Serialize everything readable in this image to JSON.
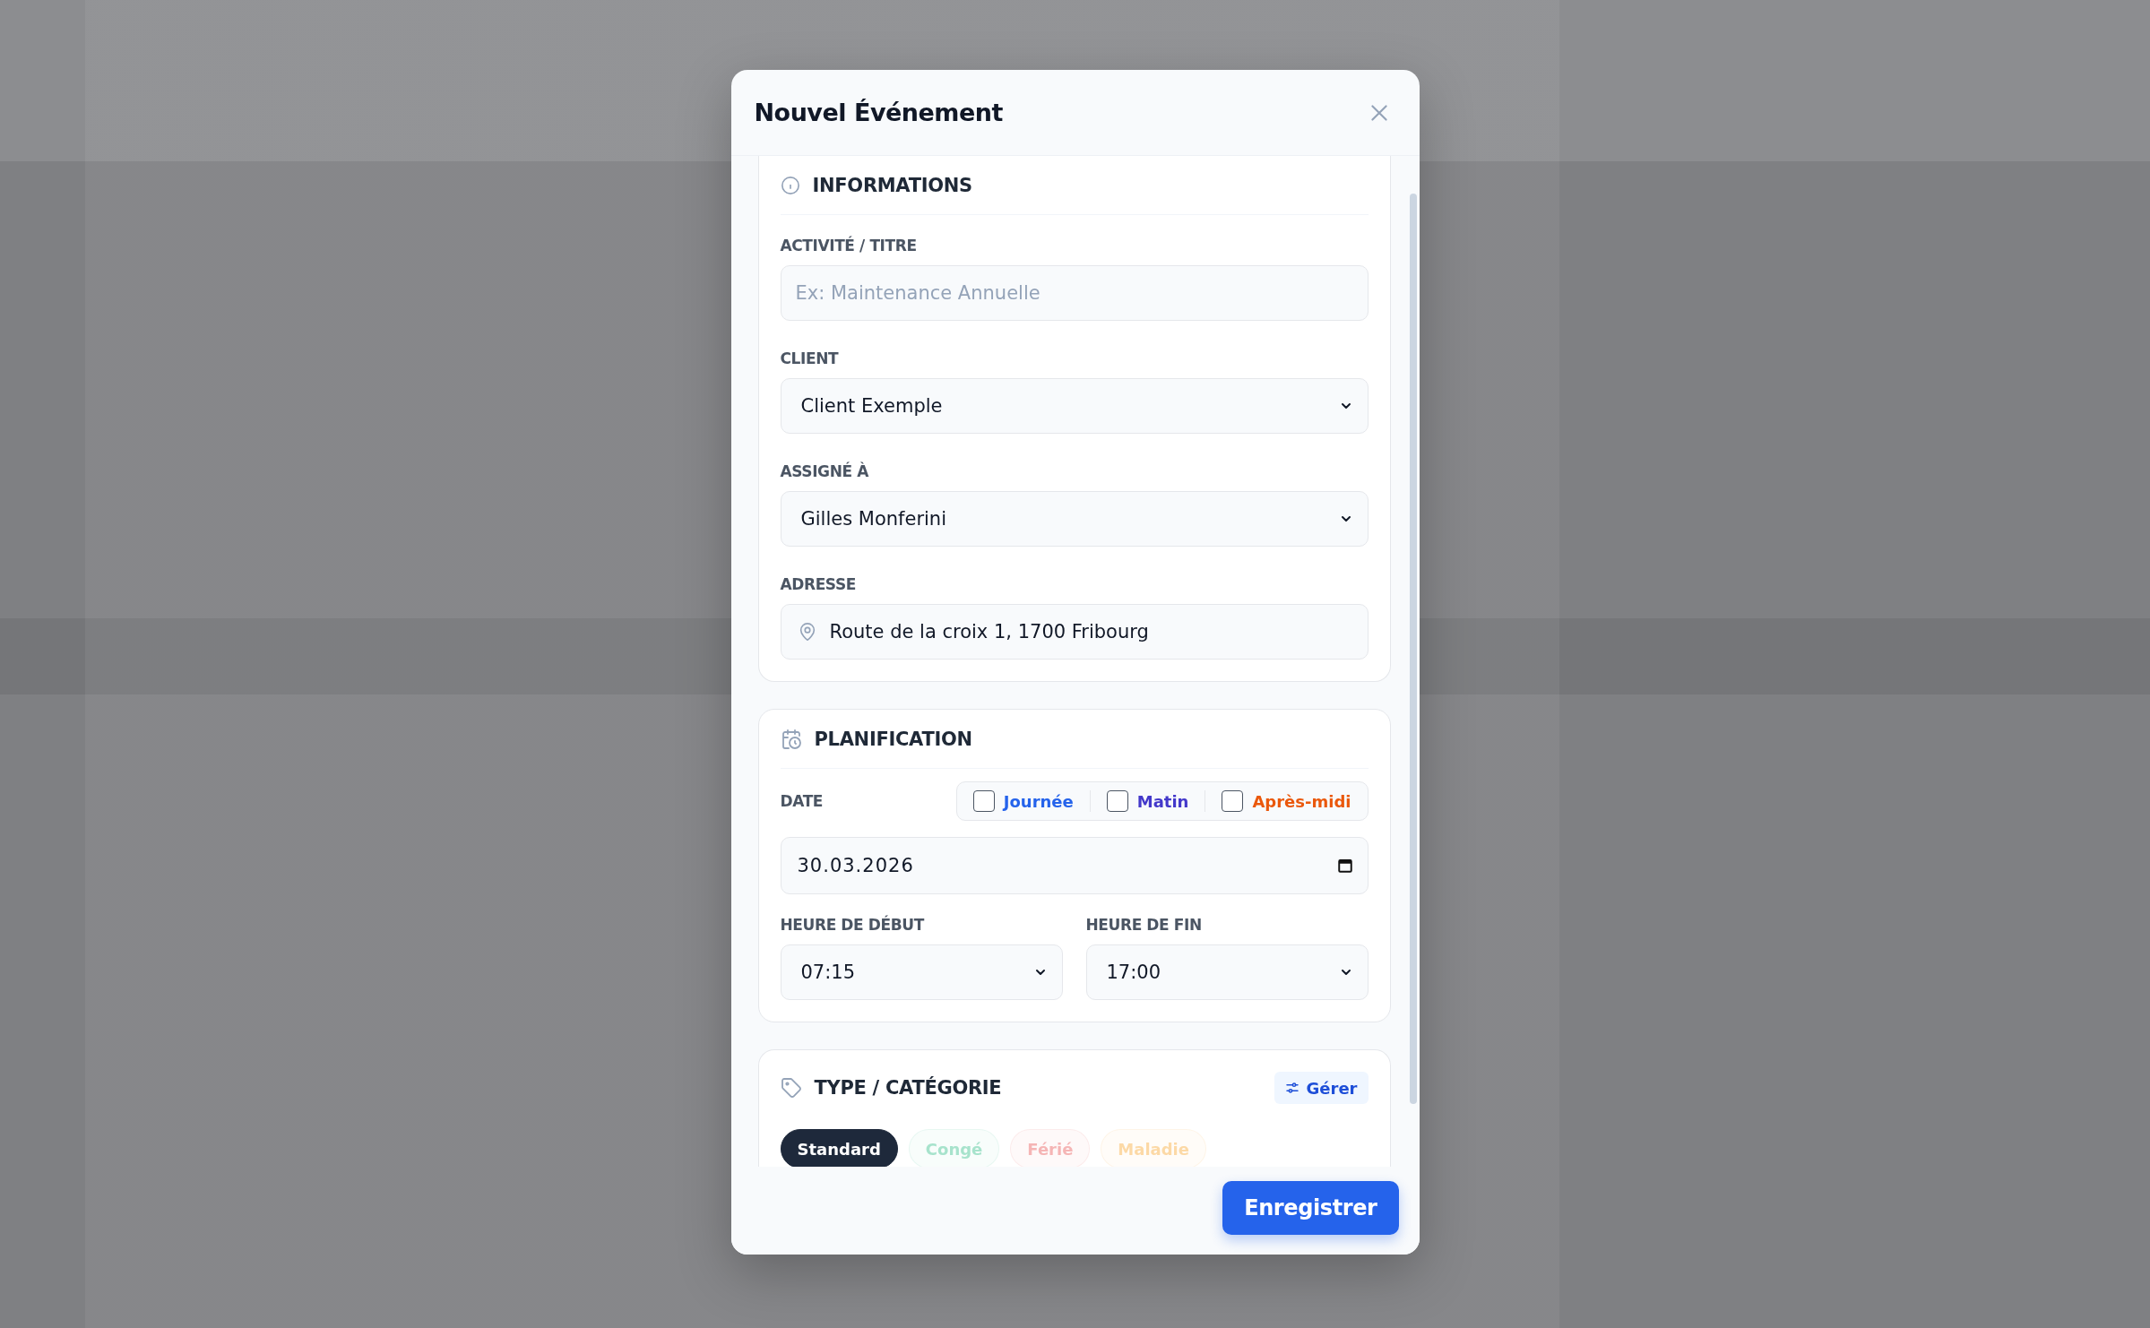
{
  "dialog": {
    "title": "Nouvel Événement"
  },
  "sections": [
    {
      "kind": "info",
      "heading": "INFORMATIONS",
      "fields": [
        {
          "kind": "text",
          "label": "ACTIVITÉ / TITRE",
          "placeholder": "Ex: Maintenance Annuelle"
        },
        {
          "kind": "select",
          "label": "CLIENT",
          "value": "Client Exemple"
        },
        {
          "kind": "select",
          "label": "ASSIGNÉ À",
          "value": "Gilles Monferini"
        },
        {
          "kind": "address",
          "label": "ADRESSE",
          "value": "Route de la croix 1, 1700 Fribourg"
        }
      ]
    },
    {
      "kind": "planning",
      "heading": "PLANIFICATION",
      "date_label": "DATE",
      "day_parts": [
        {
          "label": "Journée",
          "checked": false,
          "color": "#2563eb"
        },
        {
          "label": "Matin",
          "checked": false,
          "color": "#4338ca"
        },
        {
          "label": "Après-midi",
          "checked": false,
          "color": "#ea580c"
        }
      ],
      "date_value": "30.03.2026",
      "start": {
        "label": "HEURE DE DÉBUT",
        "value": "07:15"
      },
      "end": {
        "label": "HEURE DE FIN",
        "value": "17:00"
      }
    },
    {
      "kind": "category",
      "heading": "TYPE / CATÉGORIE",
      "manage_label": "Gérer",
      "categories": [
        {
          "label": "Standard",
          "selected": true,
          "color": "#1e293b"
        },
        {
          "label": "Congé",
          "selected": false,
          "color": "#a7e3cc"
        },
        {
          "label": "Férié",
          "selected": false,
          "color": "#f5b5b5"
        },
        {
          "label": "Maladie",
          "selected": false,
          "color": "#fcd9a6"
        }
      ]
    }
  ],
  "save_label": "Enregistrer"
}
